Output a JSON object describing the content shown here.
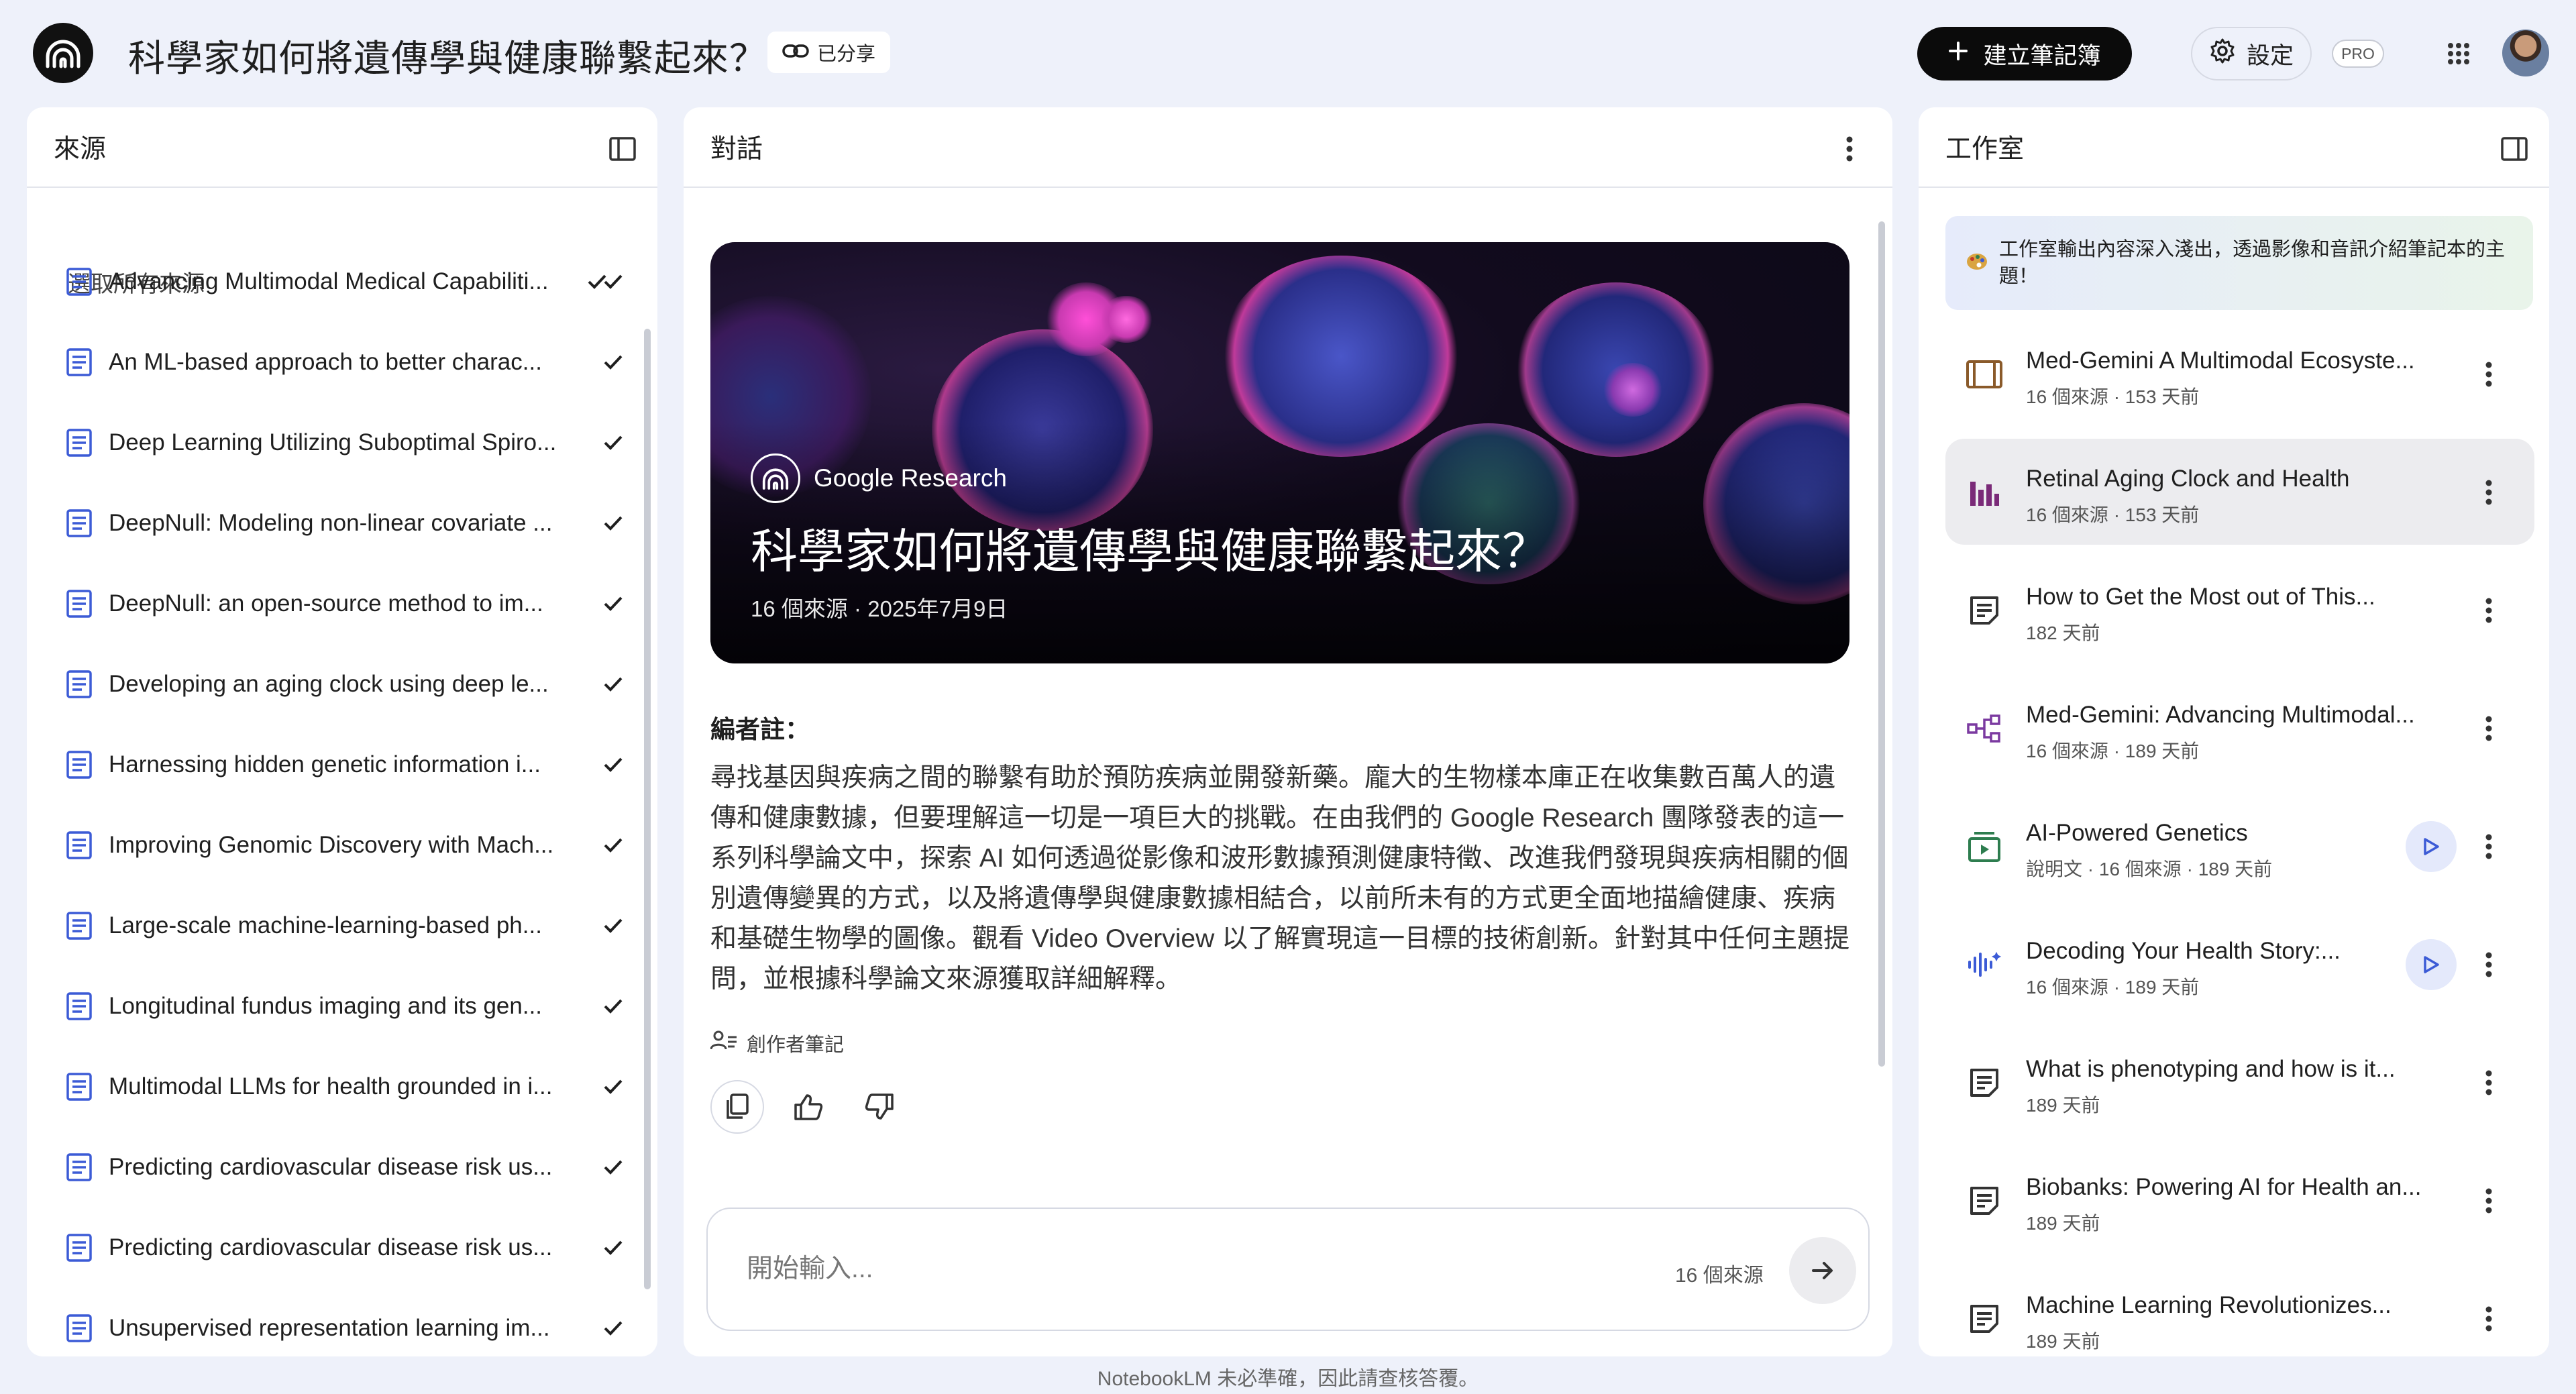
{
  "header": {
    "title": "科學家如何將遺傳學與健康聯繫起來？",
    "shared_label": "已分享",
    "create_notebook_label": "建立筆記簿",
    "settings_label": "設定",
    "pro_badge": "PRO",
    "icons": {
      "logo": "notebooklm-logo-icon",
      "link": "link-icon",
      "plus": "plus-icon",
      "gear": "gear-icon",
      "apps": "apps-grid-icon"
    }
  },
  "sources": {
    "title": "來源",
    "select_all_label": "選取所有來源",
    "select_all_checked": true,
    "items": [
      {
        "label": "Advancing Multimodal Medical Capabiliti...",
        "checked": true
      },
      {
        "label": "An ML-based approach to better charac...",
        "checked": true
      },
      {
        "label": "Deep Learning Utilizing Suboptimal Spiro...",
        "checked": true
      },
      {
        "label": "DeepNull: Modeling non-linear covariate ...",
        "checked": true
      },
      {
        "label": "DeepNull: an open-source method to im...",
        "checked": true
      },
      {
        "label": "Developing an aging clock using deep le...",
        "checked": true
      },
      {
        "label": "Harnessing hidden genetic information i...",
        "checked": true
      },
      {
        "label": "Improving Genomic Discovery with Mach...",
        "checked": true
      },
      {
        "label": "Large-scale machine-learning-based ph...",
        "checked": true
      },
      {
        "label": "Longitudinal fundus imaging and its gen...",
        "checked": true
      },
      {
        "label": "Multimodal LLMs for health grounded in i...",
        "checked": true
      },
      {
        "label": "Predicting cardiovascular disease risk us...",
        "checked": true
      },
      {
        "label": "Predicting cardiovascular disease risk us...",
        "checked": true
      },
      {
        "label": "Unsupervised representation learning im...",
        "checked": true
      }
    ]
  },
  "conversation": {
    "title": "對話",
    "hero": {
      "brand": "Google Research",
      "title": "科學家如何將遺傳學與健康聯繫起來？",
      "meta": "16 個來源 · 2025年7月9日"
    },
    "editor_heading": "編者註：",
    "editor_body": "尋找基因與疾病之間的聯繫有助於預防疾病並開發新藥。龐大的生物樣本庫正在收集數百萬人的遺傳和健康數據，但要理解這一切是一項巨大的挑戰。在由我們的 Google Research 團隊發表的這一系列科學論文中，探索 AI 如何透過從影像和波形數據預測健康特徵、改進我們發現與疾病相關的個別遺傳變異的方式，以及將遺傳學與健康數據相結合，以前所未有的方式更全面地描繪健康、疾病和基礎生物學的圖像。觀看 Video Overview 以了解實現這一目標的技術創新。針對其中任何主題提問，並根據科學論文來源獲取詳細解釋。",
    "creator_note": "創作者筆記",
    "input_placeholder": "開始輸入...",
    "source_count": "16 個來源"
  },
  "studio": {
    "title": "工作室",
    "banner": "工作室輸出內容深入淺出，透過影像和音訊介紹筆記本的主題！",
    "items": [
      {
        "title": "Med-Gemini A Multimodal Ecosyste...",
        "meta": "16 個來源 · 153 天前",
        "icon": "video-overview-icon",
        "active": false,
        "play": false
      },
      {
        "title": "Retinal Aging Clock and Health",
        "meta": "16 個來源 · 153 天前",
        "icon": "infographic-icon",
        "active": true,
        "play": false
      },
      {
        "title": "How to Get the Most out of This...",
        "meta": "182 天前",
        "icon": "note-icon",
        "active": false,
        "play": false
      },
      {
        "title": "Med-Gemini: Advancing Multimodal...",
        "meta": "16 個來源 · 189 天前",
        "icon": "mind-map-icon",
        "active": false,
        "play": false
      },
      {
        "title": "AI-Powered Genetics",
        "meta": "說明文 · 16 個來源 · 189 天前",
        "icon": "explainer-video-icon",
        "active": false,
        "play": true
      },
      {
        "title": "Decoding Your Health Story:...",
        "meta": "16 個來源 · 189 天前",
        "icon": "audio-overview-icon",
        "active": false,
        "play": true
      },
      {
        "title": "What is phenotyping and how is it...",
        "meta": "189 天前",
        "icon": "note-icon",
        "active": false,
        "play": false
      },
      {
        "title": "Biobanks: Powering AI for Health an...",
        "meta": "189 天前",
        "icon": "note-icon",
        "active": false,
        "play": false
      },
      {
        "title": "Machine Learning Revolutionizes...",
        "meta": "189 天前",
        "icon": "note-icon",
        "active": false,
        "play": false
      }
    ]
  },
  "footer": "NotebookLM 未必準確，因此請查核答覆。",
  "colors": {
    "background": "#eef1fa",
    "panel": "#ffffff",
    "accent_blue": "#3c5bd6",
    "infographic_purple": "#7a2a78",
    "mindmap_purple": "#7b3aa0",
    "explainer_green": "#2e7d4f",
    "video_brown": "#8a5a2a"
  }
}
